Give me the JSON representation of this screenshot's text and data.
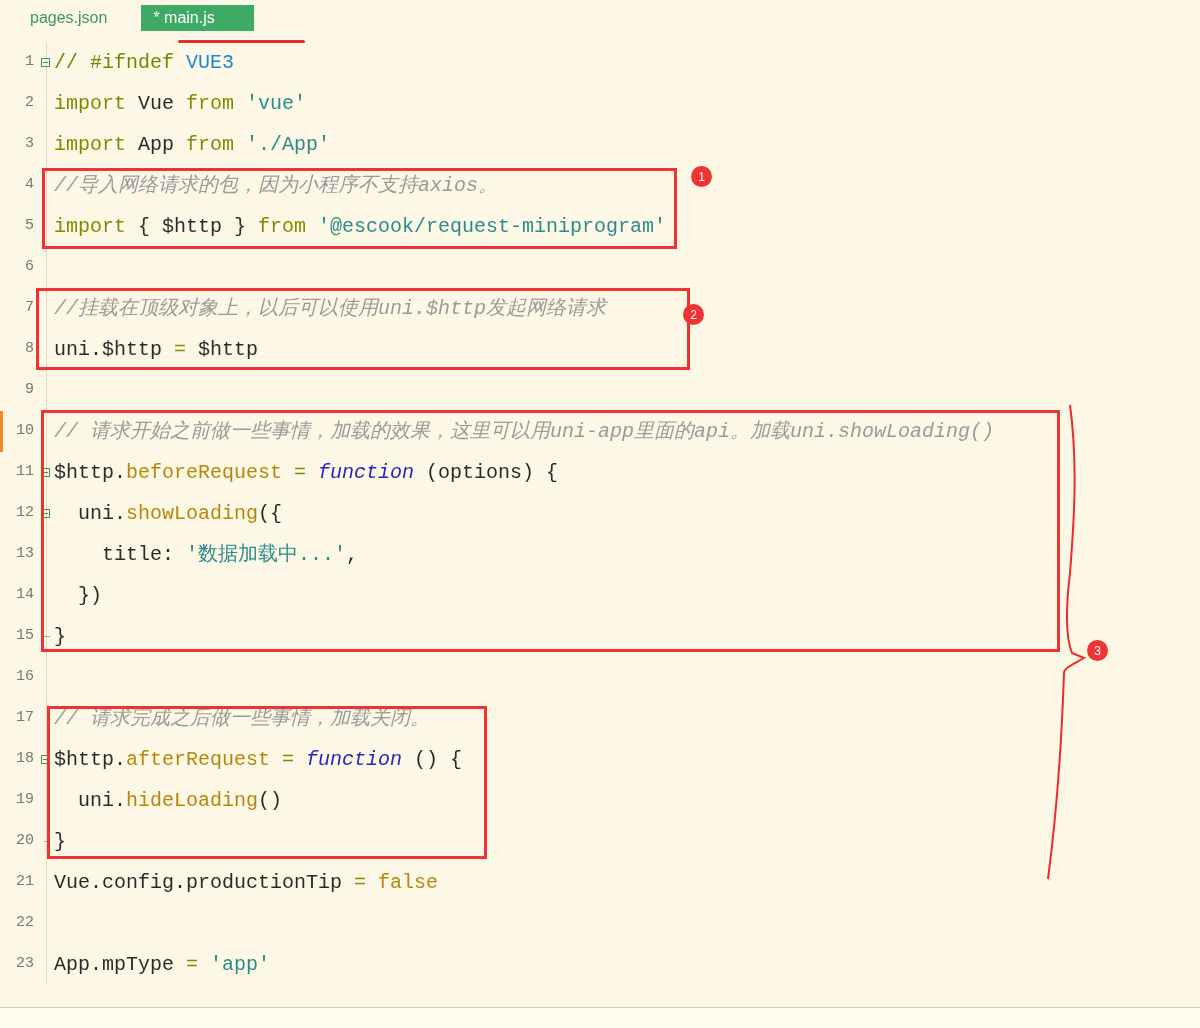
{
  "tabs": [
    {
      "label": "pages.json",
      "selected": false
    },
    {
      "label": "* main.js",
      "selected": true
    }
  ],
  "lines": [
    {
      "number": "1",
      "fold_start": true,
      "fold_end": false,
      "modified": false,
      "tokens": [
        {
          "kind": "directive",
          "text": "// #ifndef "
        },
        {
          "kind": "macro",
          "text": "VUE3"
        }
      ]
    },
    {
      "number": "2",
      "fold_start": false,
      "fold_end": false,
      "modified": false,
      "tokens": [
        {
          "kind": "keyword",
          "text": "import"
        },
        {
          "kind": "plain",
          "text": " Vue "
        },
        {
          "kind": "keyword",
          "text": "from"
        },
        {
          "kind": "string",
          "text": " 'vue'"
        }
      ]
    },
    {
      "number": "3",
      "fold_start": false,
      "fold_end": false,
      "modified": false,
      "tokens": [
        {
          "kind": "keyword",
          "text": "import"
        },
        {
          "kind": "plain",
          "text": " App "
        },
        {
          "kind": "keyword",
          "text": "from"
        },
        {
          "kind": "string",
          "text": " './App'"
        }
      ]
    },
    {
      "number": "4",
      "fold_start": false,
      "fold_end": false,
      "modified": false,
      "tokens": [
        {
          "kind": "comment",
          "text": "//导入网络请求的包，因为小程序不支持axios。"
        }
      ]
    },
    {
      "number": "5",
      "fold_start": false,
      "fold_end": false,
      "modified": false,
      "tokens": [
        {
          "kind": "keyword",
          "text": "import"
        },
        {
          "kind": "plain",
          "text": " { $http } "
        },
        {
          "kind": "keyword",
          "text": "from"
        },
        {
          "kind": "string",
          "text": " '@escook/request-miniprogram'"
        }
      ]
    },
    {
      "number": "6",
      "fold_start": false,
      "fold_end": false,
      "modified": false
    },
    {
      "number": "7",
      "fold_start": false,
      "fold_end": false,
      "modified": false,
      "tokens": [
        {
          "kind": "comment",
          "text": "//挂载在顶级对象上，以后可以使用uni.$http发起网络请求"
        }
      ]
    },
    {
      "number": "8",
      "fold_start": false,
      "fold_end": false,
      "modified": false,
      "tokens": [
        {
          "kind": "plain",
          "text": "uni.$http "
        },
        {
          "kind": "op",
          "text": "="
        },
        {
          "kind": "plain",
          "text": " $http"
        }
      ]
    },
    {
      "number": "9",
      "fold_start": false,
      "fold_end": false,
      "modified": false
    },
    {
      "number": "10",
      "fold_start": false,
      "fold_end": false,
      "modified": true,
      "tokens": [
        {
          "kind": "comment",
          "text": "// 请求开始之前做一些事情，加载的效果，这里可以用uni-app里面的api。加载uni.showLoading()"
        }
      ]
    },
    {
      "number": "11",
      "fold_start": true,
      "fold_end": false,
      "modified": false,
      "tokens": [
        {
          "kind": "plain",
          "text": "$http."
        },
        {
          "kind": "method",
          "text": "beforeRequest"
        },
        {
          "kind": "op",
          "text": " = "
        },
        {
          "kind": "func",
          "text": "function"
        },
        {
          "kind": "plain",
          "text": " (options) {"
        }
      ]
    },
    {
      "number": "12",
      "fold_start": true,
      "fold_end": false,
      "modified": false,
      "tokens": [
        {
          "kind": "plain",
          "text": "  uni."
        },
        {
          "kind": "method",
          "text": "showLoading"
        },
        {
          "kind": "plain",
          "text": "({"
        }
      ]
    },
    {
      "number": "13",
      "fold_start": false,
      "fold_end": false,
      "modified": false,
      "tokens": [
        {
          "kind": "plain",
          "text": "    title: "
        },
        {
          "kind": "string",
          "text": "'数据加载中...'"
        },
        {
          "kind": "plain",
          "text": ","
        }
      ]
    },
    {
      "number": "14",
      "fold_start": false,
      "fold_end": false,
      "modified": false,
      "tokens": [
        {
          "kind": "plain",
          "text": "  })"
        }
      ]
    },
    {
      "number": "15",
      "fold_start": false,
      "fold_end": true,
      "modified": false,
      "tokens": [
        {
          "kind": "plain",
          "text": "}"
        }
      ]
    },
    {
      "number": "16",
      "fold_start": false,
      "fold_end": false,
      "modified": false
    },
    {
      "number": "17",
      "fold_start": false,
      "fold_end": false,
      "modified": false,
      "tokens": [
        {
          "kind": "comment",
          "text": "// 请求完成之后做一些事情，加载关闭。"
        }
      ]
    },
    {
      "number": "18",
      "fold_start": true,
      "fold_end": false,
      "modified": false,
      "tokens": [
        {
          "kind": "plain",
          "text": "$http."
        },
        {
          "kind": "method",
          "text": "afterRequest"
        },
        {
          "kind": "op",
          "text": " = "
        },
        {
          "kind": "func",
          "text": "function"
        },
        {
          "kind": "plain",
          "text": " () {"
        }
      ]
    },
    {
      "number": "19",
      "fold_start": false,
      "fold_end": false,
      "modified": false,
      "tokens": [
        {
          "kind": "plain",
          "text": "  uni."
        },
        {
          "kind": "method",
          "text": "hideLoading"
        },
        {
          "kind": "plain",
          "text": "()"
        }
      ]
    },
    {
      "number": "20",
      "fold_start": false,
      "fold_end": true,
      "modified": false,
      "tokens": [
        {
          "kind": "plain",
          "text": "}"
        }
      ]
    },
    {
      "number": "21",
      "fold_start": false,
      "fold_end": false,
      "modified": false,
      "tokens": [
        {
          "kind": "plain",
          "text": "Vue.config.productionTip "
        },
        {
          "kind": "op",
          "text": "="
        },
        {
          "kind": "literal",
          "text": " false"
        }
      ]
    },
    {
      "number": "22",
      "fold_start": false,
      "fold_end": false,
      "modified": false
    },
    {
      "number": "23",
      "fold_start": false,
      "fold_end": false,
      "modified": false,
      "tokens": [
        {
          "kind": "plain",
          "text": "App.mpType "
        },
        {
          "kind": "op",
          "text": "="
        },
        {
          "kind": "string",
          "text": " 'app'"
        }
      ]
    }
  ],
  "annotations": [
    {
      "kind": "numbered",
      "badge": "1"
    },
    {
      "kind": "numbered",
      "badge": "2"
    },
    {
      "kind": "numbered",
      "badge": "3"
    },
    {
      "kind": "plain"
    }
  ]
}
